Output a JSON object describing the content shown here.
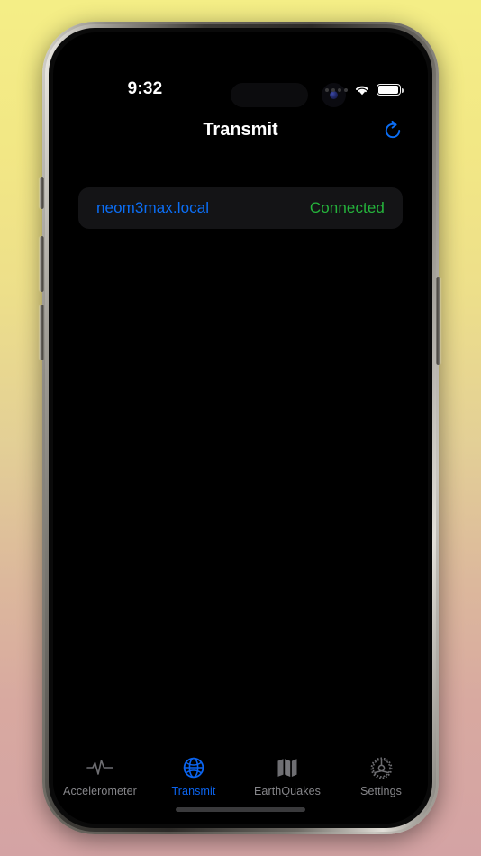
{
  "device": {
    "frame": "iphone-15-pro-max",
    "body_color": "#55524c"
  },
  "background": {
    "gradient_top": "#f4ee86",
    "gradient_bottom": "#d4a3a4"
  },
  "status_bar": {
    "time": "9:32",
    "cellular_icon": "cellular-dots-icon",
    "wifi_icon": "wifi-icon",
    "battery_icon": "battery-icon",
    "battery_level": 86
  },
  "nav_bar": {
    "title": "Transmit",
    "refresh_icon": "refresh-icon",
    "accent_color": "#0b6ef5"
  },
  "content": {
    "connection": {
      "host": "neom3max.local",
      "status": "Connected",
      "host_color": "#0b6ef5",
      "status_color": "#25b53c"
    }
  },
  "tab_bar": {
    "active_index": 1,
    "active_color": "#0b64ef",
    "inactive_color": "#86868a",
    "tabs": [
      {
        "label": "Accelerometer",
        "icon": "waveform-icon"
      },
      {
        "label": "Transmit",
        "icon": "globe-icon"
      },
      {
        "label": "EarthQuakes",
        "icon": "map-icon"
      },
      {
        "label": "Settings",
        "icon": "gear-icon"
      }
    ]
  }
}
